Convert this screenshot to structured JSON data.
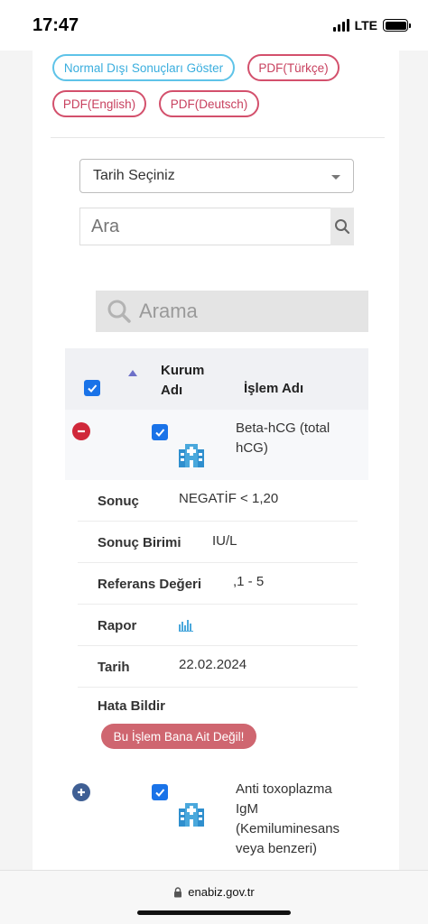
{
  "status": {
    "time": "17:47",
    "network": "LTE"
  },
  "buttons": {
    "abnormal": "Normal Dışı Sonuçları Göster",
    "pdf_tr": "PDF(Türkçe)",
    "pdf_en": "PDF(English)",
    "pdf_de": "PDF(Deutsch)"
  },
  "filter": {
    "date_select": "Tarih Seçiniz",
    "search_placeholder": "Ara",
    "table_search_placeholder": "Arama"
  },
  "table": {
    "headers": {
      "institution": "Kurum Adı",
      "institution_l1": "Kurum",
      "institution_l2": "Adı",
      "procedure": "İşlem Adı"
    },
    "rows": [
      {
        "name_l1": "Beta-hCG (total",
        "name_l2": "hCG)",
        "details": {
          "result_label": "Sonuç",
          "result_value": "NEGATİF < 1,20",
          "unit_label": "Sonuç Birimi",
          "unit_value": "IU/L",
          "reference_label": "Referans Değeri",
          "reference_value": ",1 - 5",
          "report_label": "Rapor",
          "report_icon": "bar-chart-icon",
          "date_label": "Tarih",
          "date_value": "22.02.2024",
          "error_label": "Hata Bildir",
          "error_button": "Bu İşlem Bana Ait Değil!"
        }
      },
      {
        "name_l1": "Anti toxoplazma",
        "name_l2": "IgM",
        "name_l3": "(Kemiluminesans",
        "name_l4": "veya benzeri)"
      }
    ]
  },
  "browser": {
    "url": "enabiz.gov.tr"
  },
  "colors": {
    "accent_blue": "#1a73e8",
    "pdf_red": "#d3506c",
    "collapse_red": "#d0283a",
    "expand_blue": "#3f5f94",
    "report_button": "#cf6670"
  }
}
